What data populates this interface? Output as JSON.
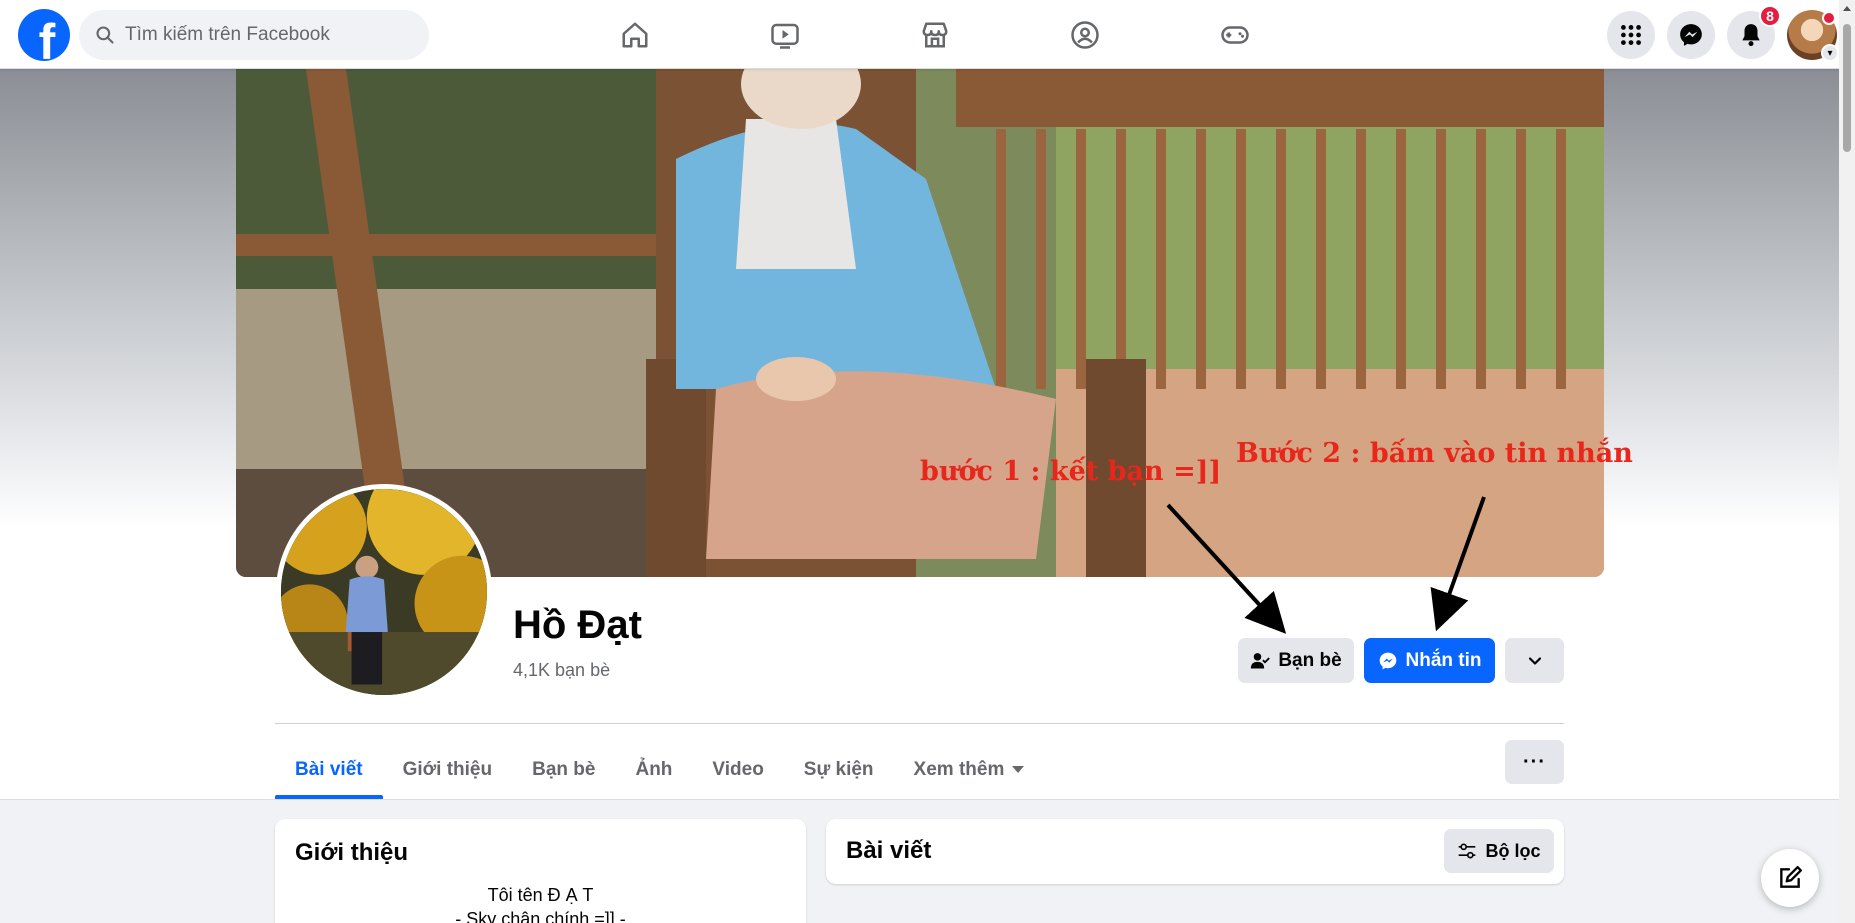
{
  "topbar": {
    "search_placeholder": "Tìm kiếm trên Facebook",
    "notification_count": "8",
    "nav_icons": [
      "home-icon",
      "video-icon",
      "marketplace-icon",
      "groups-icon",
      "gaming-icon"
    ],
    "right_icons": [
      "menu-grid-icon",
      "messenger-icon",
      "bell-icon"
    ]
  },
  "profile": {
    "name": "Hồ Đạt",
    "friends_count": "4,1K bạn bè"
  },
  "actions": {
    "friends_label": "Bạn bè",
    "message_label": "Nhắn tin"
  },
  "tabs": [
    {
      "label": "Bài viết"
    },
    {
      "label": "Giới thiệu"
    },
    {
      "label": "Bạn bè"
    },
    {
      "label": "Ảnh"
    },
    {
      "label": "Video"
    },
    {
      "label": "Sự kiện"
    },
    {
      "label": "Xem thêm"
    }
  ],
  "intro": {
    "title": "Giới thiệu",
    "bio_line1": "Tôi tên Đ Ạ T",
    "bio_line2": "- Sky chân chính =]] -"
  },
  "posts": {
    "title": "Bài viết",
    "filter_label": "Bộ lọc"
  },
  "annotations": {
    "step1": "bước 1 : kết bạn =]]",
    "step2": "Bước 2 : bấm vào tin nhắn"
  },
  "colors": {
    "brand": "#0866ff",
    "annotation": "#e8261b",
    "badge": "#e41e3f"
  }
}
